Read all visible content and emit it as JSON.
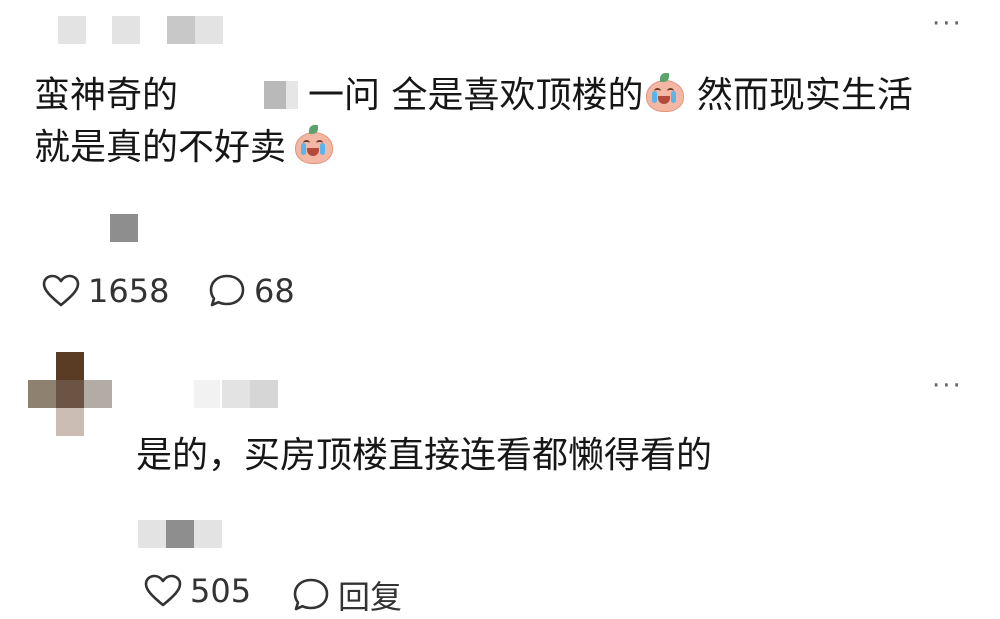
{
  "comments": [
    {
      "text_part1": "蛮神奇的",
      "text_part2": "一问 全是喜欢顶楼的",
      "emoji_name": "crying-face-emoji",
      "text_part3": " 然而现实生活",
      "text_line2": "就是真的不好卖",
      "likes": "1658",
      "replies": "68",
      "more": "···"
    },
    {
      "text": "是的，买房顶楼直接连看都懒得看的",
      "likes": "505",
      "reply_label": "回复",
      "more": "···"
    }
  ],
  "icons": {
    "like": "heart-outline-icon",
    "comment": "speech-bubble-icon",
    "more": "more-dots-icon"
  },
  "colors": {
    "text": "#161616",
    "meta": "#333333",
    "blur": "#c8c8c8"
  }
}
